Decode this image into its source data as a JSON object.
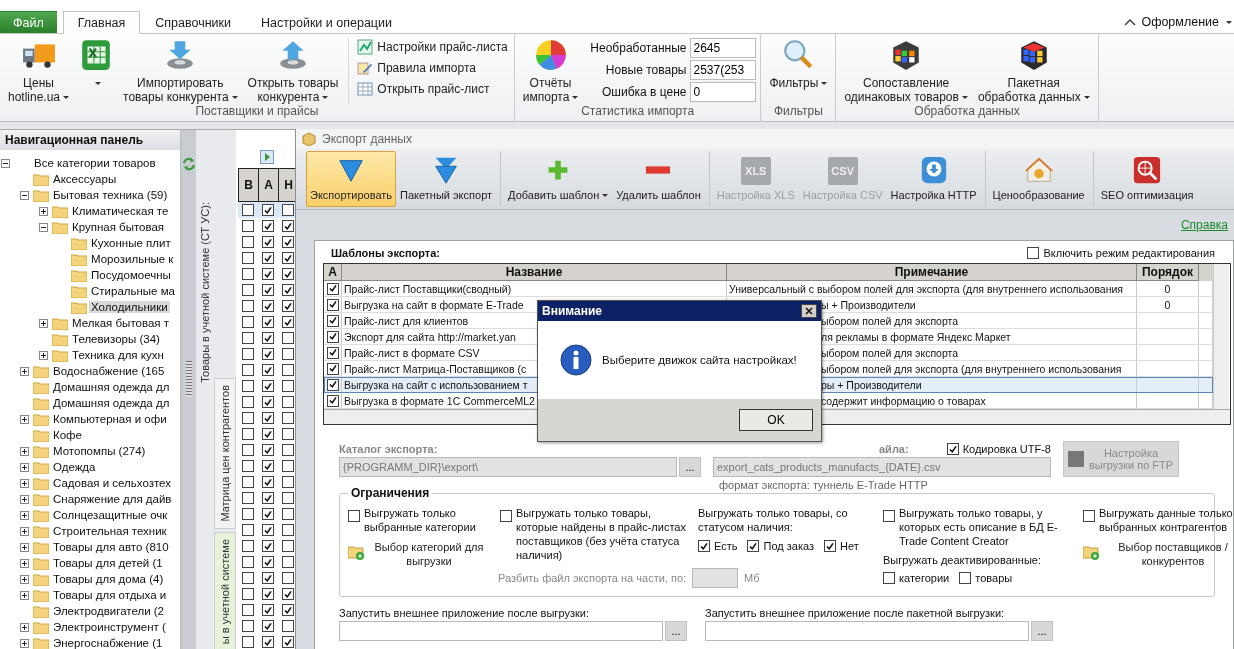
{
  "ribbon": {
    "tabs": [
      {
        "label": "Файл",
        "kind": "file",
        "selected": false
      },
      {
        "label": "Главная",
        "kind": "tab",
        "selected": true
      },
      {
        "label": "Справочники",
        "kind": "tab",
        "selected": false
      },
      {
        "label": "Настройки и операции",
        "kind": "tab",
        "selected": false
      }
    ],
    "theme_menu": "Оформление",
    "groups": [
      {
        "label": "Поставщики и прайсы",
        "large": [
          {
            "lines": [
              "Цены",
              "hotline.ua"
            ],
            "dropdown": true
          },
          {
            "dropdown": true
          },
          {
            "lines": [
              "Импортировать",
              "товары конкурента"
            ],
            "dropdown": true
          },
          {
            "lines": [
              "Открыть товары",
              "конкурента"
            ],
            "dropdown": true
          }
        ],
        "small": [
          "Настройки прайс-листа",
          "Правила импорта",
          "Открыть прайс-лист"
        ]
      },
      {
        "label": "Статистика импорта",
        "large": [
          {
            "lines": [
              "Отчёты",
              "импорта"
            ],
            "dropdown": true
          }
        ],
        "stats": [
          {
            "label": "Необработанные",
            "value": "2645"
          },
          {
            "label": "Новые товары",
            "value": "2537(253"
          },
          {
            "label": "Ошибка в цене",
            "value": "0"
          }
        ]
      },
      {
        "label": "Фильтры",
        "large": [
          {
            "lines": [
              "Фильтры"
            ],
            "dropdown": true
          }
        ]
      },
      {
        "label": "Обработка данных",
        "large": [
          {
            "lines": [
              "Сопоставление",
              "одинаковых товаров"
            ],
            "dropdown": true
          },
          {
            "lines": [
              "Пакетная",
              "обработка данных"
            ],
            "dropdown": true
          }
        ]
      }
    ]
  },
  "navigation": {
    "title": "Навигационная панель",
    "tree": [
      {
        "label": "Все категории товаров",
        "expanded": true,
        "selected": false,
        "children": [
          {
            "label": "Аксессуары",
            "selected": false
          },
          {
            "label": "Бытовая техника (59)",
            "expanded": true,
            "selected": false,
            "children": [
              {
                "label": "Климатическая те",
                "expanded": false,
                "selected": false
              },
              {
                "label": "Крупная бытовая",
                "expanded": true,
                "selected": false,
                "children": [
                  {
                    "label": "Кухонные плит",
                    "selected": false
                  },
                  {
                    "label": "Морозильные к",
                    "selected": false
                  },
                  {
                    "label": "Посудомоечны",
                    "selected": false
                  },
                  {
                    "label": "Стиральные ма",
                    "selected": false
                  },
                  {
                    "label": "Холодильники",
                    "selected": true
                  }
                ]
              },
              {
                "label": "Мелкая бытовая т",
                "expanded": false,
                "selected": false
              },
              {
                "label": "Телевизоры (34)",
                "selected": false
              },
              {
                "label": "Техника для кухн",
                "expanded": false,
                "selected": false
              }
            ]
          },
          {
            "label": "Водоснабжение (165",
            "expanded": false,
            "selected": false
          },
          {
            "label": "Домашняя одежда дл",
            "selected": false
          },
          {
            "label": "Домашняя одежда дл",
            "selected": false
          },
          {
            "label": "Компьютерная и офи",
            "expanded": false,
            "selected": false
          },
          {
            "label": "Кофе",
            "selected": false
          },
          {
            "label": "Мотопомпы (274)",
            "expanded": false,
            "selected": false
          },
          {
            "label": "Одежда",
            "expanded": false,
            "selected": false
          },
          {
            "label": "Садовая и сельхозтех",
            "expanded": false,
            "selected": false
          },
          {
            "label": "Снаряжение для дайв",
            "expanded": false,
            "selected": false
          },
          {
            "label": "Солнцезащитные очк",
            "expanded": false,
            "selected": false
          },
          {
            "label": "Строительная техник",
            "expanded": false,
            "selected": false
          },
          {
            "label": "Товары для авто (810",
            "expanded": false,
            "selected": false
          },
          {
            "label": "Товары для детей (1",
            "expanded": false,
            "selected": false
          },
          {
            "label": "Товары для дома (4)",
            "expanded": false,
            "selected": false
          },
          {
            "label": "Товары для отдыха и",
            "expanded": false,
            "selected": false
          },
          {
            "label": "Электродвигатели (2",
            "selected": false
          },
          {
            "label": "Электроинструмент (",
            "expanded": false,
            "selected": false
          },
          {
            "label": "Энергоснабжение (1",
            "expanded": false,
            "selected": false
          }
        ]
      }
    ]
  },
  "side_caption": "Товары в учетной системе (СТ УС):",
  "side_tabs": [
    {
      "label": "Матрица цен контрагентов",
      "selected": false
    },
    {
      "label": "ы в учетной системе",
      "selected": true
    }
  ],
  "grid": {
    "columns": [
      "В",
      "А",
      "Н"
    ],
    "rows": [
      {
        "selected": true,
        "checks": [
          false,
          true,
          false
        ]
      },
      {
        "selected": false,
        "checks": [
          false,
          true,
          true
        ]
      },
      {
        "selected": false,
        "checks": [
          false,
          true,
          true
        ]
      },
      {
        "selected": false,
        "checks": [
          false,
          true,
          true
        ]
      },
      {
        "selected": false,
        "checks": [
          false,
          true,
          true
        ]
      },
      {
        "selected": false,
        "checks": [
          false,
          true,
          true
        ]
      },
      {
        "selected": false,
        "checks": [
          false,
          true,
          true
        ]
      },
      {
        "selected": false,
        "checks": [
          false,
          true,
          true
        ]
      },
      {
        "selected": false,
        "checks": [
          false,
          true,
          false
        ]
      },
      {
        "selected": false,
        "checks": [
          false,
          true,
          false
        ]
      },
      {
        "selected": false,
        "checks": [
          false,
          true,
          false
        ]
      },
      {
        "selected": false,
        "checks": [
          false,
          true,
          false
        ]
      },
      {
        "selected": false,
        "checks": [
          false,
          true,
          false
        ]
      },
      {
        "selected": false,
        "checks": [
          false,
          true,
          false
        ]
      },
      {
        "selected": false,
        "checks": [
          false,
          true,
          false
        ]
      },
      {
        "selected": false,
        "checks": [
          false,
          true,
          false
        ]
      },
      {
        "selected": false,
        "checks": [
          false,
          true,
          false
        ]
      },
      {
        "selected": false,
        "checks": [
          false,
          true,
          false
        ]
      },
      {
        "selected": false,
        "checks": [
          false,
          true,
          false
        ]
      },
      {
        "selected": false,
        "checks": [
          false,
          true,
          false
        ]
      },
      {
        "selected": false,
        "checks": [
          false,
          true,
          false
        ]
      },
      {
        "selected": false,
        "checks": [
          false,
          true,
          false
        ]
      },
      {
        "selected": false,
        "checks": [
          false,
          true,
          false
        ]
      },
      {
        "selected": false,
        "checks": [
          false,
          true,
          false
        ]
      },
      {
        "selected": false,
        "checks": [
          false,
          true,
          true
        ]
      },
      {
        "selected": false,
        "checks": [
          false,
          true,
          true
        ]
      },
      {
        "selected": false,
        "checks": [
          false,
          true,
          false
        ]
      },
      {
        "selected": false,
        "checks": [
          false,
          true,
          true
        ]
      }
    ]
  },
  "dialog": {
    "title": "Экспорт данных",
    "toolbar": [
      {
        "label": "Экспортировать",
        "selected": true,
        "disabled": false,
        "dropdown": false,
        "separator_before": false
      },
      {
        "label": "Пакетный экспорт",
        "selected": false,
        "disabled": false,
        "dropdown": false,
        "separator_before": false
      },
      {
        "label": "Добавить шаблон",
        "selected": false,
        "disabled": false,
        "dropdown": true,
        "separator_before": true
      },
      {
        "label": "Удалить шаблон",
        "selected": false,
        "disabled": false,
        "dropdown": false,
        "separator_before": false
      },
      {
        "label": "Настройка XLS",
        "badge": "XLS",
        "selected": false,
        "disabled": true,
        "dropdown": false,
        "separator_before": true
      },
      {
        "label": "Настройка CSV",
        "badge": "CSV",
        "selected": false,
        "disabled": true,
        "dropdown": false,
        "separator_before": false
      },
      {
        "label": "Настройка HTTP",
        "selected": false,
        "disabled": false,
        "dropdown": false,
        "separator_before": false
      },
      {
        "label": "Ценообразование",
        "selected": false,
        "disabled": false,
        "dropdown": false,
        "separator_before": true
      },
      {
        "label": "SEO оптимизация",
        "selected": false,
        "disabled": false,
        "dropdown": false,
        "separator_before": true
      }
    ],
    "help_link": "Справка",
    "templates": {
      "label": "Шаблоны экспорта:",
      "edit_mode": {
        "label": "Включить режим редактирования",
        "checked": false
      },
      "columns": [
        "А",
        "Название",
        "Примечание",
        "Порядок"
      ],
      "rows": [
        {
          "active": true,
          "selected": false,
          "name": "Прайс-лист Поставщики(сводный)",
          "note": "Универсальный с выбором полей для экспорта (для внутреннего использования",
          "order": "0"
        },
        {
          "active": true,
          "selected": false,
          "name": "Выгрузка на сайт в формате E-Trade",
          "note": "ы + Производители",
          "order": "0"
        },
        {
          "active": true,
          "selected": false,
          "name": "Прайс-лист для клиентов",
          "note": "ыбором полей для экспорта"
        },
        {
          "active": true,
          "selected": false,
          "name": "Экспорт для сайта http://market.yan",
          "note": "ля рекламы в формате Яндекс Маркет"
        },
        {
          "active": true,
          "selected": false,
          "name": "Прайс-лист в формате CSV",
          "note": "ыбором полей для экспорта"
        },
        {
          "active": true,
          "selected": false,
          "name": "Прайс-лист Матрица-Поставщиков (с",
          "note": "ыбором полей для экспорта (для внутреннего использования"
        },
        {
          "active": true,
          "selected": true,
          "name": "Выгрузка на сайт с использованием т",
          "note": "ры + Производители"
        },
        {
          "active": true,
          "selected": false,
          "name": "Выгрузка в формате 1С CommerceML2",
          "note": "содержит информацию о товарах"
        }
      ]
    },
    "catalog": {
      "label": "Каталог экспорта:",
      "value": "{PROGRAMM_DIR}\\export\\",
      "disabled": true,
      "browse": "..."
    },
    "file": {
      "label": "айла:",
      "value": "export_cats_products_manufacts_{DATE}.csv",
      "disabled": true,
      "caption": "формат экспорта: туннель E-Trade HTTP"
    },
    "utf8": {
      "label": "Кодировка UTF-8",
      "checked": true
    },
    "ftp_button": {
      "label": "Настройка выгрузки по FTP",
      "disabled": true
    },
    "restrictions": {
      "title": "Ограничения",
      "selected_categories": {
        "label": "Выгружать только выбранные категории",
        "checked": false
      },
      "choose_categories": "Выбор категорий для выгрузки",
      "found_only": {
        "label": "Выгружать только товары, которые найдены в прайс-листах поставщиков (без учёта статуса наличия)",
        "checked": false
      },
      "split": {
        "label": "Разбить файл экспорта на части, по:",
        "unit": "Мб",
        "disabled": true
      },
      "availability": {
        "label": "Выгружать только товары, со статусом наличия:",
        "options": [
          {
            "label": "Есть",
            "checked": true
          },
          {
            "label": "Под заказ",
            "checked": true
          },
          {
            "label": "Нет",
            "checked": true
          }
        ]
      },
      "described_only": {
        "label": "Выгружать только товары, у которых есть описание в БД E-Trade Content Creator",
        "checked": false
      },
      "deactivated": {
        "label": "Выгружать деактивированные:",
        "options": [
          {
            "label": "категории",
            "checked": false
          },
          {
            "label": "товары",
            "checked": false
          }
        ]
      },
      "selected_partners": {
        "label": "Выгружать данные только выбранных контрагентов",
        "checked": false
      },
      "choose_partners": "Выбор поставщиков / конкурентов"
    },
    "run_after": [
      {
        "label": "Запустить внешнее приложение после выгрузки:",
        "browse": "..."
      },
      {
        "label": "Запустить внешнее приложение после пакетной выгрузки:",
        "browse": "..."
      }
    ],
    "message": {
      "title": "Внимание",
      "text": "Выберите движок сайта настройках!",
      "button": "OK"
    }
  }
}
